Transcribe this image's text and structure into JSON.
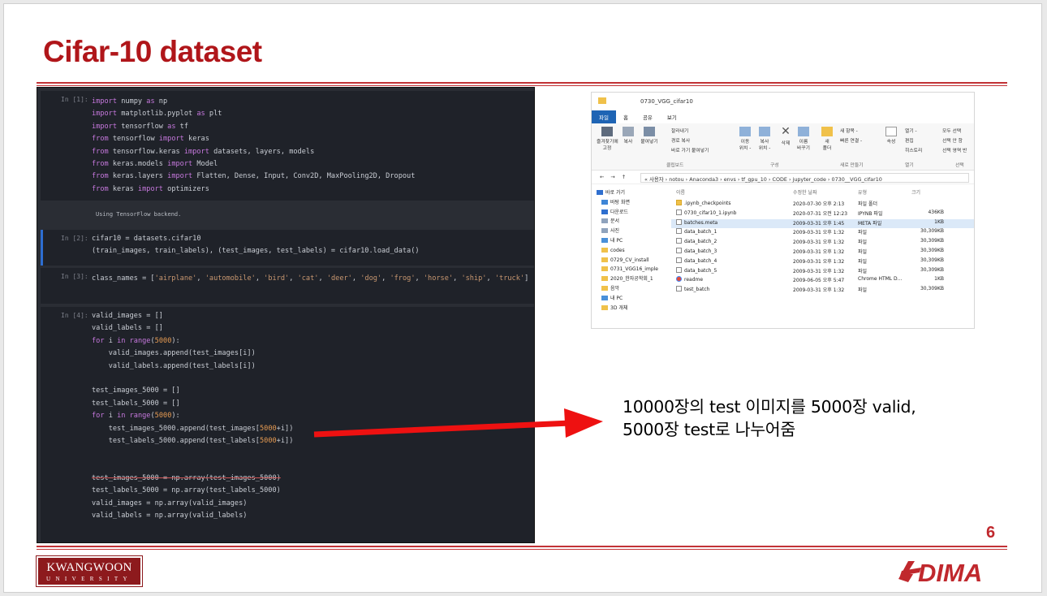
{
  "slide": {
    "title": "Cifar-10 dataset",
    "page_number": "6",
    "description_line1": "10000장의 test 이미지를 5000장 valid,",
    "description_line2": "5000장 test로 나누어줌",
    "logo_left_line1": "KWANGWOON",
    "logo_left_line2": "UNIVERSITY",
    "logo_right": "DIMA",
    "accent_color": "#b0161a"
  },
  "notebook": {
    "cells": [
      {
        "prompt": "In [1]:",
        "lines": [
          "import numpy as np",
          "import matplotlib.pyplot as plt",
          "import tensorflow as tf",
          "from tensorflow import keras",
          "from tensorflow.keras import datasets, layers, models",
          "from keras.models import Model",
          "from keras.layers import Flatten, Dense, Input, Conv2D, MaxPooling2D, Dropout",
          "from keras import optimizers"
        ],
        "output": "Using TensorFlow backend."
      },
      {
        "prompt": "In [2]:",
        "lines": [
          "cifar10 = datasets.cifar10",
          "(train_images, train_labels), (test_images, test_labels) = cifar10.load_data()"
        ]
      },
      {
        "prompt": "In [3]:",
        "lines": [
          "class_names = ['airplane', 'automobile', 'bird', 'cat', 'deer', 'dog', 'frog', 'horse', 'ship', 'truck']"
        ]
      },
      {
        "prompt": "In [4]:",
        "lines": [
          "valid_images = []",
          "valid_labels = []",
          "for i in range(5000):",
          "    valid_images.append(test_images[i])",
          "    valid_labels.append(test_labels[i])",
          "",
          "test_images_5000 = []",
          "test_labels_5000 = []",
          "for i in range(5000):",
          "    test_images_5000.append(test_images[5000+i])",
          "    test_labels_5000.append(test_labels[5000+i])",
          "",
          "",
          "test_images_5000 = np.array(test_images_5000)",
          "test_labels_5000 = np.array(test_labels_5000)",
          "valid_images = np.array(valid_images)",
          "valid_labels = np.array(valid_labels)"
        ]
      }
    ]
  },
  "explorer": {
    "window_title": "0730_VGG_cifar10",
    "tabs": [
      "파일",
      "홈",
      "공유",
      "보기"
    ],
    "ribbon": {
      "pin": "즐겨찾기에\n고정",
      "copy": "복사",
      "paste": "붙여넣기",
      "cut": "잘라내기",
      "copy_path": "경로 복사",
      "paste_shortcut": "바로 가기 붙여넣기",
      "move_to": "이동\n위치 -",
      "copy_to": "복사\n위치 -",
      "delete": "삭제",
      "rename": "이름\n바꾸기",
      "new_folder": "새\n폴더",
      "new_item": "새 항목 -",
      "easy_access": "빠른 연결 -",
      "properties": "속성",
      "open": "열기 -",
      "edit": "편집",
      "history": "히스토리",
      "select_all": "모두 선택",
      "select_none": "선택 안 함",
      "invert_selection": "선택 영역 반",
      "group_clipboard": "클립보드",
      "group_organize": "구성",
      "group_new": "새로 만들기",
      "group_open": "열기",
      "group_select": "선택"
    },
    "address": "« 사용자 › notou › Anaconda3 › envs › tf_gpu_10 › CODE › jupyter_code › 0730__VGG_cifar10",
    "nav": [
      {
        "label": "바로 가기",
        "type": "star"
      },
      {
        "label": "바탕 화면",
        "type": "desktop"
      },
      {
        "label": "다운로드",
        "type": "download"
      },
      {
        "label": "문서",
        "type": "doc"
      },
      {
        "label": "사진",
        "type": "pic"
      },
      {
        "label": "내 PC",
        "type": "pc"
      },
      {
        "label": "codes",
        "type": "folder"
      },
      {
        "label": "0729_CV_install",
        "type": "folder"
      },
      {
        "label": "0731_VGG16_imple",
        "type": "folder"
      },
      {
        "label": "2020_한자공학회_1",
        "type": "folder"
      },
      {
        "label": "음악",
        "type": "folder"
      },
      {
        "label": "내 PC",
        "type": "pc"
      },
      {
        "label": "3D 개체",
        "type": "folder"
      }
    ],
    "columns": [
      "이름",
      "수정한 날짜",
      "유형",
      "크기"
    ],
    "files": [
      {
        "name": ".ipynb_checkpoints",
        "date": "2020-07-30 오후 2:13",
        "type": "파일 폴더",
        "size": "",
        "icon": "folder"
      },
      {
        "name": "0730_cifar10_1.ipynb",
        "date": "2020-07-31 오전 12:23",
        "type": "IPYNB 파일",
        "size": "436KB",
        "icon": "file"
      },
      {
        "name": "batches.meta",
        "date": "2009-03-31 오후 1:45",
        "type": "META 파일",
        "size": "1KB",
        "icon": "file",
        "selected": true
      },
      {
        "name": "data_batch_1",
        "date": "2009-03-31 오후 1:32",
        "type": "파일",
        "size": "30,309KB",
        "icon": "file"
      },
      {
        "name": "data_batch_2",
        "date": "2009-03-31 오후 1:32",
        "type": "파일",
        "size": "30,309KB",
        "icon": "file"
      },
      {
        "name": "data_batch_3",
        "date": "2009-03-31 오후 1:32",
        "type": "파일",
        "size": "30,309KB",
        "icon": "file"
      },
      {
        "name": "data_batch_4",
        "date": "2009-03-31 오후 1:32",
        "type": "파일",
        "size": "30,309KB",
        "icon": "file"
      },
      {
        "name": "data_batch_5",
        "date": "2009-03-31 오후 1:32",
        "type": "파일",
        "size": "30,309KB",
        "icon": "file"
      },
      {
        "name": "readme",
        "date": "2009-06-05 오후 5:47",
        "type": "Chrome HTML D...",
        "size": "1KB",
        "icon": "chrome"
      },
      {
        "name": "test_batch",
        "date": "2009-03-31 오후 1:32",
        "type": "파일",
        "size": "30,309KB",
        "icon": "file"
      }
    ]
  }
}
